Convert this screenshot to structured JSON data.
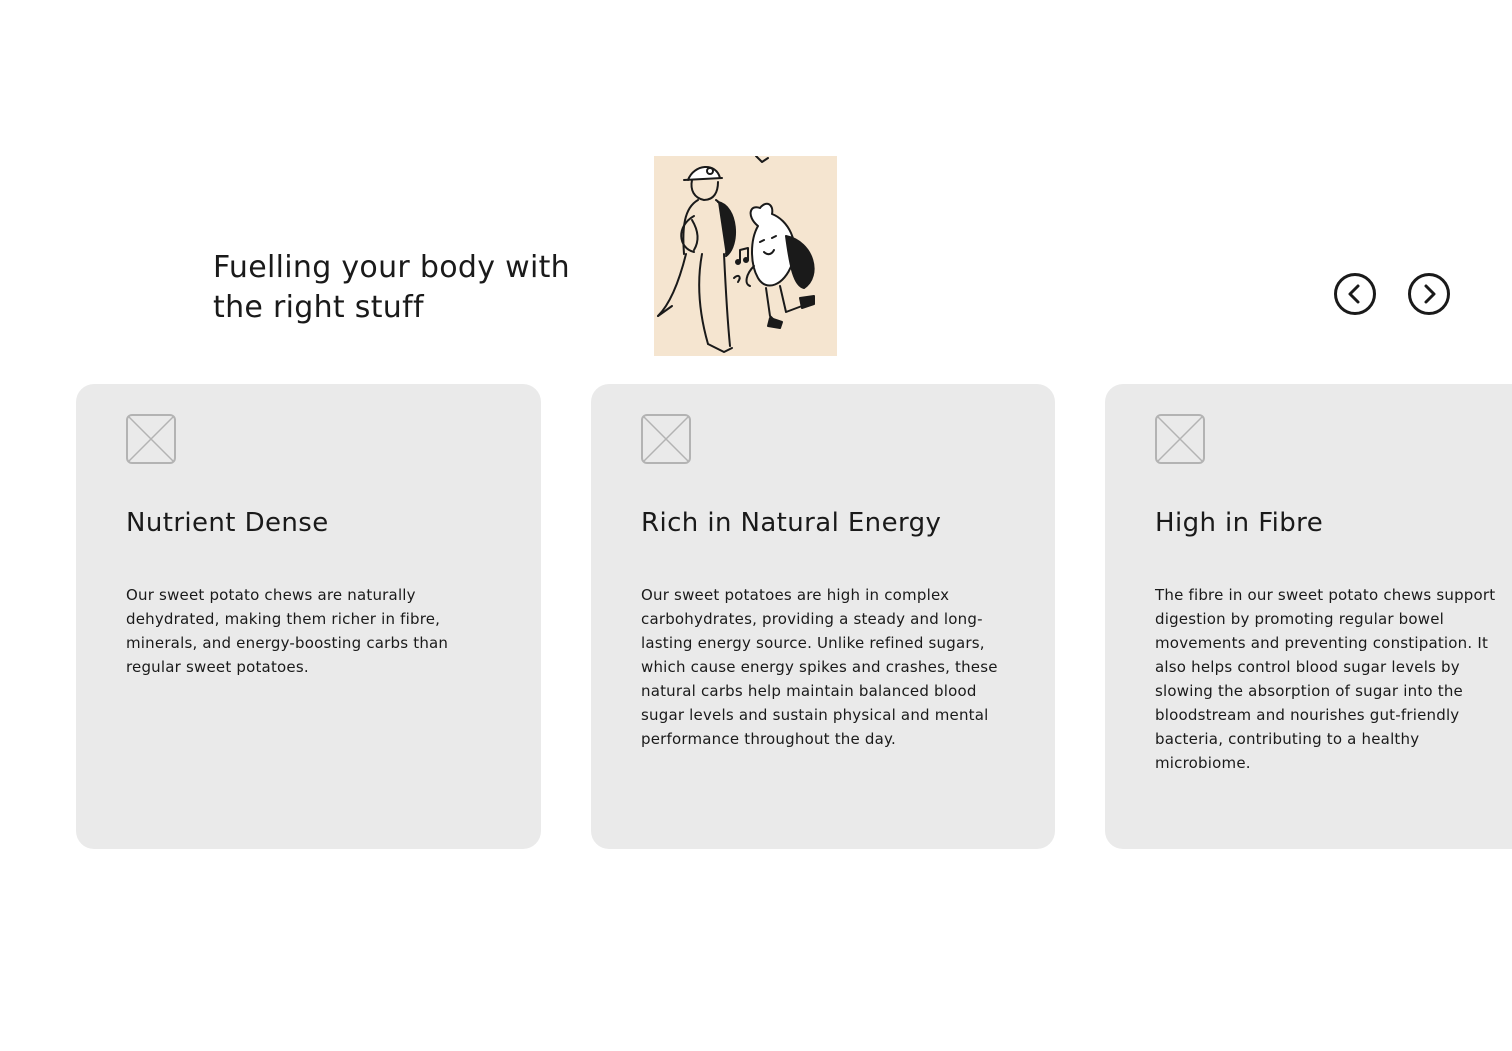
{
  "section": {
    "headline": "Fuelling your body with the right stuff"
  },
  "illustration": {
    "alt": "Illustration of a person walking with a sweet potato character",
    "background": "#f5e5d0"
  },
  "navigation": {
    "prev_icon": "chevron-left-circle-icon",
    "next_icon": "chevron-right-circle-icon"
  },
  "cards": [
    {
      "icon": "image-placeholder-icon",
      "title": "Nutrient Dense",
      "body": "Our sweet potato chews are naturally dehydrated, making them richer in fibre, minerals, and energy-boosting carbs than regular sweet potatoes."
    },
    {
      "icon": "image-placeholder-icon",
      "title": "Rich in Natural Energy",
      "body": "Our sweet potatoes are high in complex carbohydrates, providing a steady and long-lasting energy source. Unlike refined sugars, which cause energy spikes and crashes, these natural carbs help maintain balanced blood sugar levels and sustain physical and mental performance throughout the day."
    },
    {
      "icon": "image-placeholder-icon",
      "title": "High in Fibre",
      "body": "The fibre in our sweet potato chews support digestion by promoting regular bowel movements and preventing constipation. It also helps control blood sugar levels by slowing the absorption of sugar into the bloodstream and nourishes gut-friendly bacteria, contributing to a healthy microbiome."
    }
  ],
  "colors": {
    "card_background": "#eaeaea",
    "text": "#1a1a1a",
    "icon_stroke": "#b3b3b3"
  }
}
